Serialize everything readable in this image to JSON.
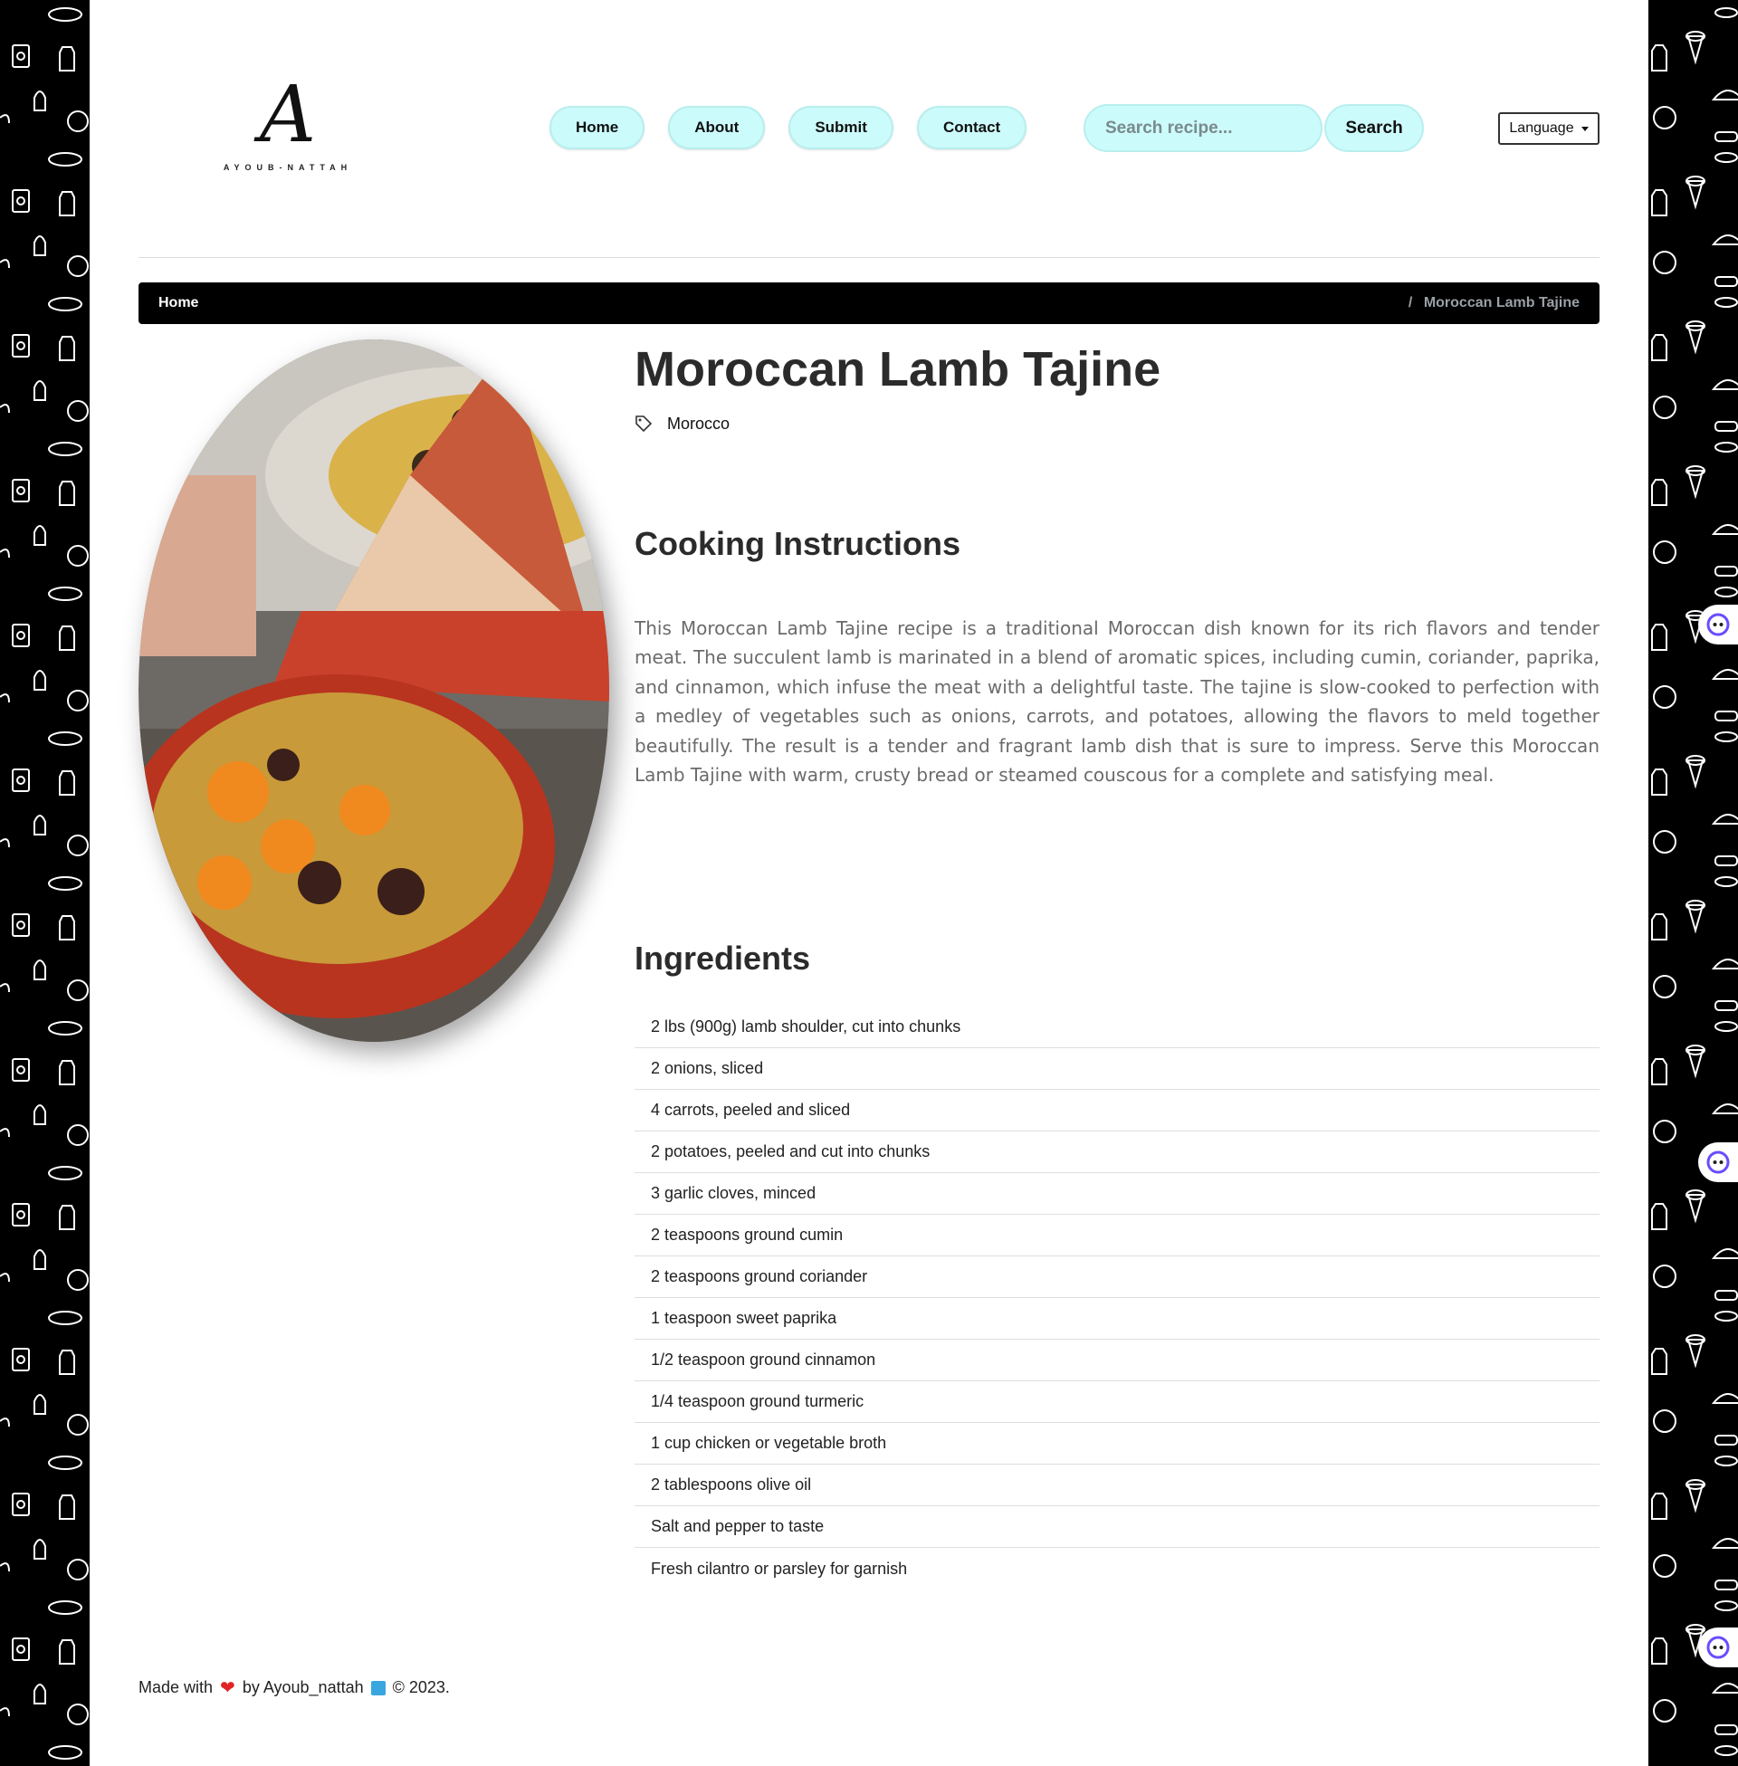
{
  "brand": {
    "logo_mark": "A",
    "logo_text": "AYOUB-NATTAH"
  },
  "nav": [
    {
      "label": "Home"
    },
    {
      "label": "About"
    },
    {
      "label": "Submit"
    },
    {
      "label": "Contact"
    }
  ],
  "search": {
    "placeholder": "Search recipe...",
    "button_label": "Search"
  },
  "language": {
    "label": "Language"
  },
  "breadcrumb": {
    "home": "Home",
    "separator": "/",
    "current": "Moroccan Lamb Tajine"
  },
  "recipe": {
    "title": "Moroccan Lamb Tajine",
    "tag": "Morocco",
    "instructions_heading": "Cooking Instructions",
    "instructions": "This Moroccan Lamb Tajine recipe is a traditional Moroccan dish known for its rich flavors and tender meat. The succulent lamb is marinated in a blend of aromatic spices, including cumin, coriander, paprika, and cinnamon, which infuse the meat with a delightful taste. The tajine is slow-cooked to perfection with a medley of vegetables such as onions, carrots, and potatoes, allowing the flavors to meld together beautifully. The result is a tender and fragrant lamb dish that is sure to impress. Serve this Moroccan Lamb Tajine with warm, crusty bread or steamed couscous for a complete and satisfying meal.",
    "ingredients_heading": "Ingredients",
    "ingredients": [
      "2 lbs (900g) lamb shoulder, cut into chunks",
      "2 onions, sliced",
      "4 carrots, peeled and sliced",
      "2 potatoes, peeled and cut into chunks",
      "3 garlic cloves, minced",
      "2 teaspoons ground cumin",
      "2 teaspoons ground coriander",
      "1 teaspoon sweet paprika",
      "1/2 teaspoon ground cinnamon",
      "1/4 teaspoon ground turmeric",
      "1 cup chicken or vegetable broth",
      "2 tablespoons olive oil",
      "Salt and pepper to taste",
      "Fresh cilantro or parsley for garnish"
    ]
  },
  "footer": {
    "made_with": "Made with",
    "by": "by Ayoub_nattah",
    "copyright": "© 2023."
  },
  "colors": {
    "nav_bg": "#ccfbfb",
    "breadcrumb_bg": "#000000",
    "accent_purple": "#6a4cff"
  },
  "icons": {
    "tag": "tag-icon",
    "heart": "heart-icon",
    "book": "book-icon",
    "assistant": "assistant-icon"
  }
}
